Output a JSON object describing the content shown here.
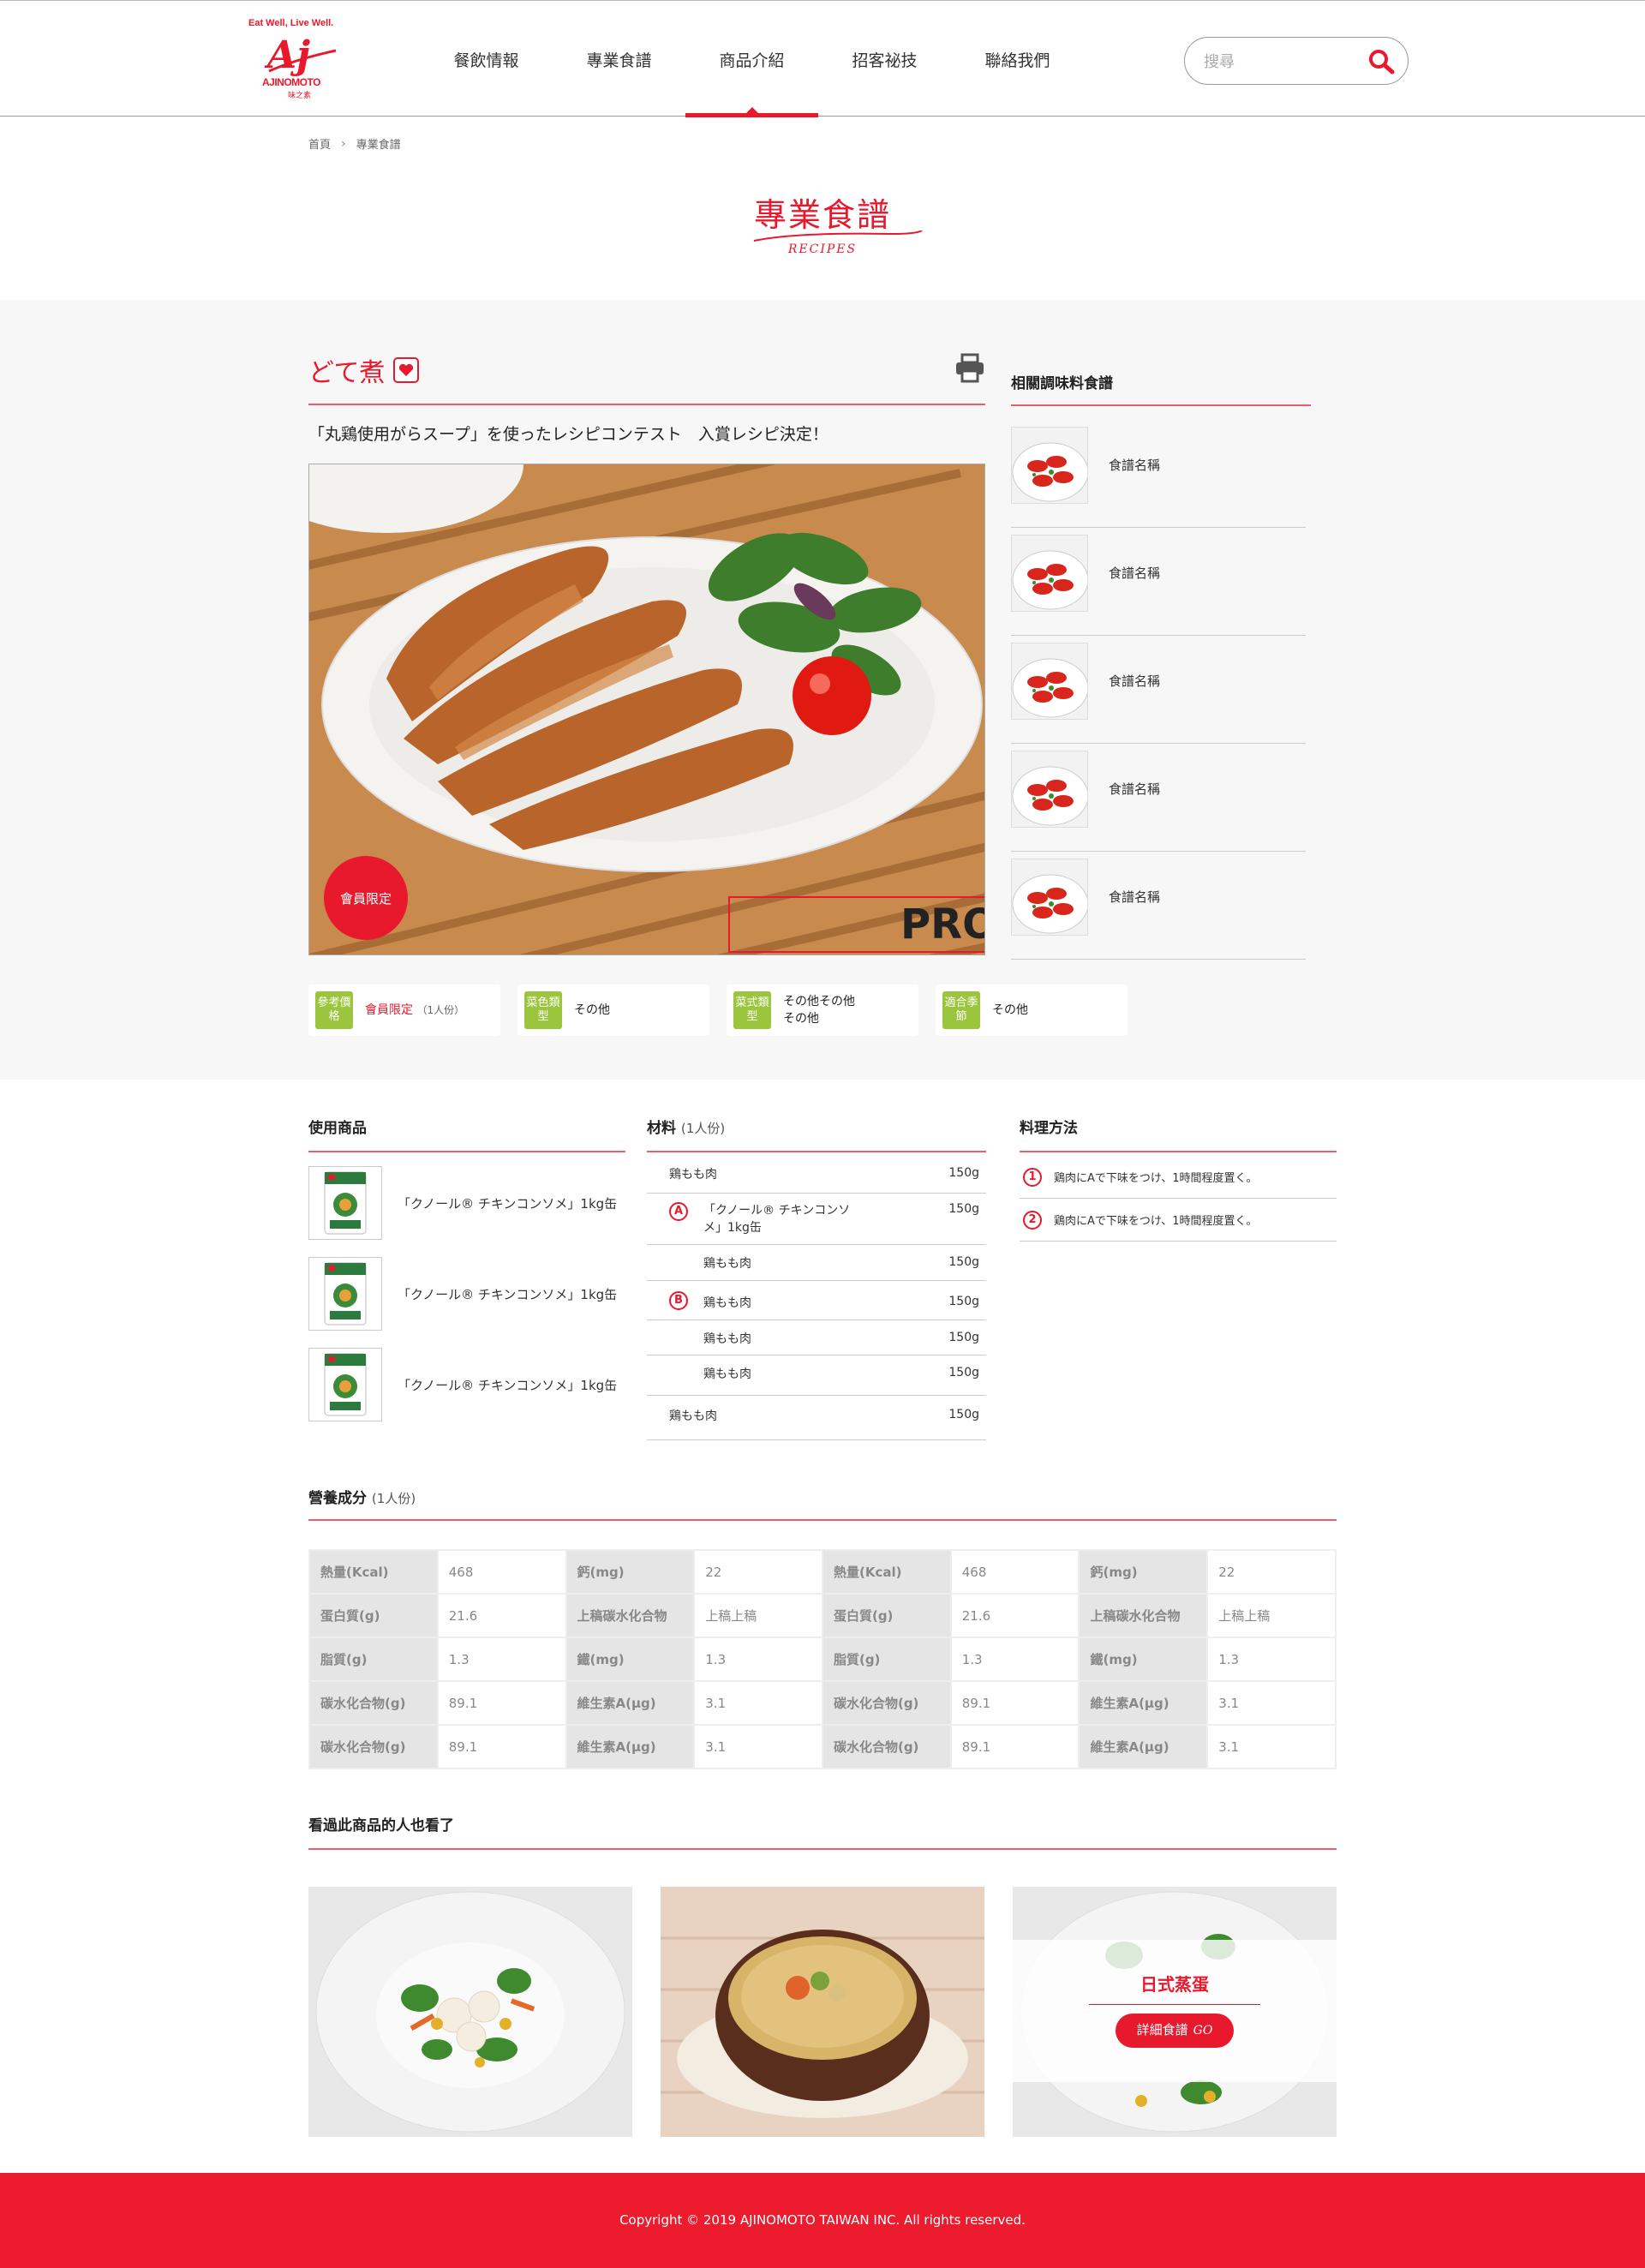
{
  "brand": {
    "tagline": "Eat Well, Live Well.",
    "name": "AJINOMOTO",
    "sub": "味之素",
    "mark": "Aj"
  },
  "nav": [
    "餐飲情報",
    "專業食譜",
    "商品介紹",
    "招客祕技",
    "聯絡我們"
  ],
  "nav_active": 2,
  "search": {
    "placeholder": "搜尋"
  },
  "breadcrumb": {
    "home": "首頁",
    "current": "專業食譜"
  },
  "page_title": {
    "zh": "專業食譜",
    "en": "RECIPES"
  },
  "recipe": {
    "title": "どて煮",
    "subtitle": "「丸鶏使用がらスープ」を使ったレシピコンテスト　入賞レシピ決定！",
    "member_badge": "會員限定",
    "watermark": "PRO",
    "tags": [
      {
        "label": "參考價格",
        "value": "會員限定",
        "note": "（1人份）"
      },
      {
        "label": "菜色類型",
        "value": "その他"
      },
      {
        "label": "菜式類型",
        "value": "その他その他",
        "value2": "その他"
      },
      {
        "label": "適合季節",
        "value": "その他"
      }
    ]
  },
  "related": {
    "heading": "相關調味料食譜",
    "items": [
      "食譜名稱",
      "食譜名稱",
      "食譜名稱",
      "食譜名稱",
      "食譜名稱"
    ]
  },
  "products": {
    "heading": "使用商品",
    "items": [
      "「クノール® チキンコンソメ」1kg缶",
      "「クノール® チキンコンソメ」1kg缶",
      "「クノール® チキンコンソメ」1kg缶"
    ]
  },
  "ingredients": {
    "heading": "材料",
    "serving": "(1人份)",
    "rows": [
      {
        "name": "鶏もも肉",
        "qty": "150g"
      },
      {
        "name": "「クノール® チキンコンソ",
        "name2": "メ」1kg缶",
        "qty": "150g",
        "group": "A"
      },
      {
        "name": "鶏もも肉",
        "qty": "150g"
      },
      {
        "name": "鶏もも肉",
        "qty": "150g",
        "group": "B"
      },
      {
        "name": "鶏もも肉",
        "qty": "150g"
      },
      {
        "name": "鶏もも肉",
        "qty": "150g"
      },
      {
        "name": "鶏もも肉",
        "qty": "150g"
      }
    ]
  },
  "method": {
    "heading": "料理方法",
    "steps": [
      "鶏肉にAで下味をつけ、1時間程度置く。",
      "鶏肉にAで下味をつけ、1時間程度置く。"
    ]
  },
  "nutrition": {
    "heading": "營養成分",
    "serving": "(1人份)",
    "rows": [
      [
        "熱量(Kcal)",
        "468",
        "鈣(mg)",
        "22",
        "熱量(Kcal)",
        "468",
        "鈣(mg)",
        "22"
      ],
      [
        "蛋白質(g)",
        "21.6",
        "上稿碳水化合物",
        "上稿上稿",
        "蛋白質(g)",
        "21.6",
        "上稿碳水化合物",
        "上稿上稿"
      ],
      [
        "脂質(g)",
        "1.3",
        "鐵(mg)",
        "1.3",
        "脂質(g)",
        "1.3",
        "鐵(mg)",
        "1.3"
      ],
      [
        "碳水化合物(g)",
        "89.1",
        "維生素A(μg)",
        "3.1",
        "碳水化合物(g)",
        "89.1",
        "維生素A(μg)",
        "3.1"
      ],
      [
        "碳水化合物(g)",
        "89.1",
        "維生素A(μg)",
        "3.1",
        "碳水化合物(g)",
        "89.1",
        "維生素A(μg)",
        "3.1"
      ]
    ]
  },
  "also": {
    "heading": "看過此商品的人也看了",
    "overlay_title": "日式蒸蛋",
    "overlay_button": "詳細食譜",
    "overlay_go": "GO"
  },
  "footer": {
    "copyright": "Copyright © 2019 AJINOMOTO TAIWAN INC. All rights reserved."
  },
  "colors": {
    "accent": "#e8192c",
    "tag_green": "#9bc53d",
    "band": "#f7f7f7"
  }
}
